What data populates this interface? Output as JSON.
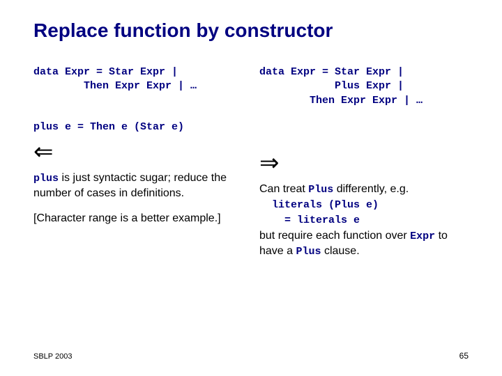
{
  "title": "Replace function by constructor",
  "left": {
    "code1": "data Expr = Star Expr |",
    "code2": "        Then Expr Expr | …",
    "code3": "plus e = Then e (Star e)",
    "arrow": "⇐",
    "p1a": "plus",
    "p1b": " is just syntactic sugar; reduce the number of cases in definitions.",
    "p2": "[Character range is a better example.]"
  },
  "right": {
    "code1": "data Expr = Star Expr |",
    "code2": "            Plus Expr |",
    "code3": "        Then Expr Expr | …",
    "arrow": "⇒",
    "p1a": "Can treat ",
    "p1b": "Plus",
    "p1c": " differently, e.g.",
    "lit1": "literals (Plus e)",
    "lit2": "  = literals e",
    "p2a": "but require each function over ",
    "p2b": "Expr",
    "p2c": " to have a ",
    "p2d": "Plus",
    "p2e": " clause."
  },
  "footer": {
    "left": "SBLP 2003",
    "right": "65"
  }
}
